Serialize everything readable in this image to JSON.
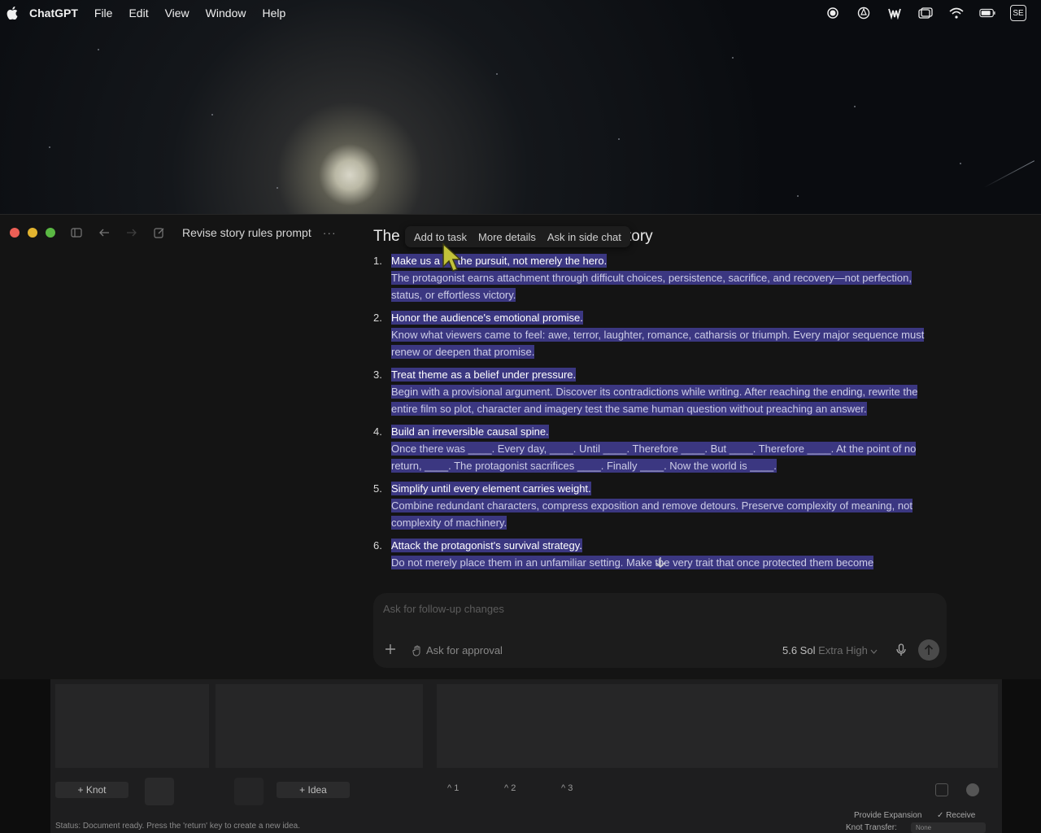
{
  "menubar": {
    "app_name": "ChatGPT",
    "items": [
      "File",
      "Edit",
      "View",
      "Window",
      "Help"
    ],
    "status_icons": [
      "record-icon",
      "openai-icon",
      "app-icon",
      "window-icon",
      "wifi-icon",
      "battery-icon",
      "input-source-icon"
    ],
    "input_source": "SE"
  },
  "window": {
    "conversation_title": "Revise story rules prompt",
    "more_label": "···",
    "heading_start": "The :",
    "heading_end": "tory",
    "context_menu": [
      "Add to task",
      "More details",
      "Ask in side chat"
    ],
    "rules": [
      {
        "num": "1.",
        "title": "Make us a  ire the pursuit, not merely the hero.",
        "text": "The protagonist earns attachment through difficult choices, persistence, sacrifice, and recovery—not perfection, status, or effortless victory."
      },
      {
        "num": "2.",
        "title": "Honor the audience's emotional promise.",
        "text": "Know what viewers came to feel: awe, terror, laughter, romance, catharsis or triumph. Every major sequence must renew or deepen that promise."
      },
      {
        "num": "3.",
        "title": "Treat theme as a belief under pressure.",
        "text": "Begin with a provisional argument. Discover its contradictions while writing. After reaching the ending, rewrite the entire film so plot, character and imagery test the same human question without preaching an answer."
      },
      {
        "num": "4.",
        "title": "Build an irreversible causal spine.",
        "text": "Once there was ____. Every day, ____. Until ____. Therefore ____. But ____. Therefore ____. At the point of no return, ____. The protagonist sacrifices ____. Finally ____. Now the world is ____."
      },
      {
        "num": "5.",
        "title": "Simplify until every element carries weight.",
        "text": "Combine redundant characters, compress exposition and remove detours. Preserve complexity of meaning, not complexity of machinery."
      },
      {
        "num": "6.",
        "title": "Attack the protagonist's survival strategy.",
        "text": "Do not merely place them in an unfamiliar setting. Make the very trait that once protected them become"
      }
    ],
    "composer": {
      "placeholder": "Ask for follow-up changes",
      "approval_label": "Ask for approval",
      "model_name": "5.6 Sol",
      "model_effort": "Extra High"
    }
  },
  "background_app": {
    "knot_button": "+ Knot",
    "idea_button": "+ Idea",
    "tools": [
      "^ 1",
      "^ 2",
      "^ 3"
    ],
    "status": "Status: Document ready. Press the 'return' key to create a new idea.",
    "provide_expansion": "Provide Expansion",
    "receive": "Receive",
    "knot_transfer_label": "Knot Transfer:",
    "knot_transfer_value": "None"
  }
}
